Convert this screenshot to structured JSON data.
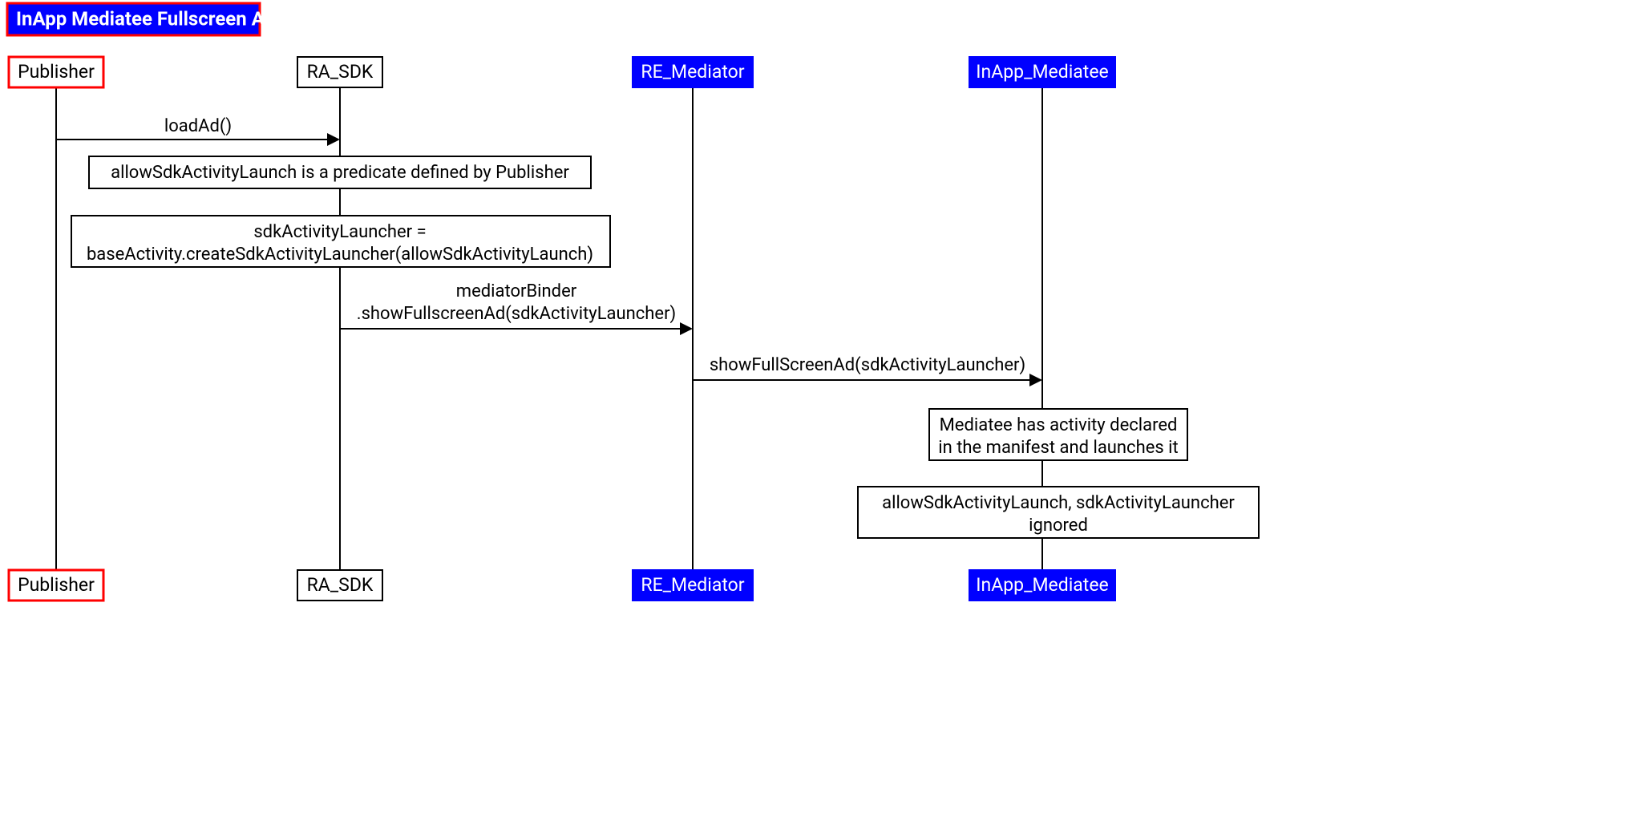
{
  "title": "InApp Mediatee Fullscreen Ad",
  "participants": {
    "publisher": "Publisher",
    "ra_sdk": "RA_SDK",
    "re_mediator": "RE_Mediator",
    "inapp_mediatee": "InApp_Mediatee"
  },
  "messages": {
    "loadAd": "loadAd()",
    "mediatorBinder_l1": "mediatorBinder",
    "mediatorBinder_l2": ".showFullscreenAd(sdkActivityLauncher)",
    "showFullscreen": "showFullScreenAd(sdkActivityLauncher)"
  },
  "notes": {
    "allowPredicate": "allowSdkActivityLaunch is a predicate defined by Publisher",
    "sdkLauncher_l1": "sdkActivityLauncher =",
    "sdkLauncher_l2": "baseActivity.createSdkActivityLauncher(allowSdkActivityLaunch)",
    "mediateeDeclared_l1": "Mediatee has activity declared",
    "mediateeDeclared_l2": "in the manifest and launches it",
    "ignored_l1": "allowSdkActivityLaunch, sdkActivityLauncher",
    "ignored_l2": "ignored"
  }
}
